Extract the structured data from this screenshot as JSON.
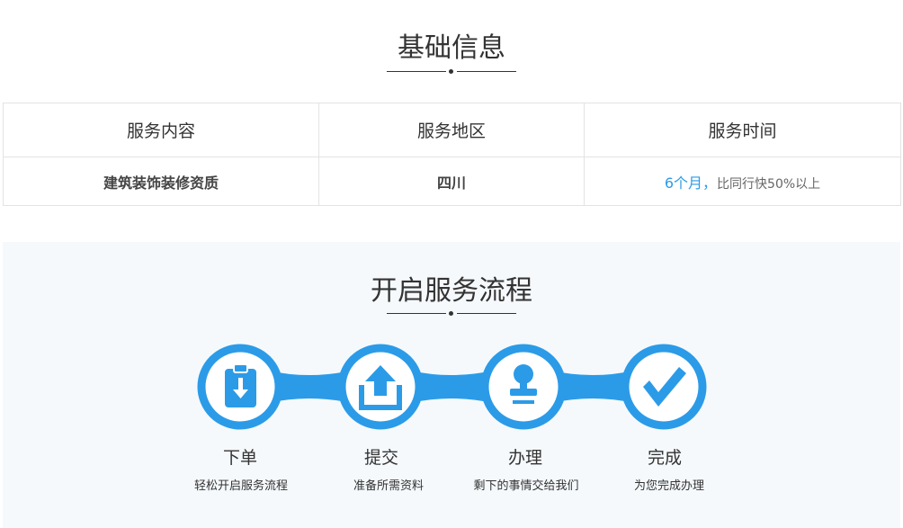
{
  "basic_info": {
    "title": "基础信息",
    "table": {
      "headers": [
        "服务内容",
        "服务地区",
        "服务时间"
      ],
      "row": {
        "content": "建筑装饰装修资质",
        "region": "四川",
        "period_highlight": "6个月，",
        "period_rest": "比同行快50%以上"
      }
    }
  },
  "process": {
    "title": "开启服务流程",
    "accent_color": "#2b9be8",
    "steps": [
      {
        "icon": "clipboard-download-icon",
        "title": "下单",
        "desc": "轻松开启服务流程"
      },
      {
        "icon": "upload-icon",
        "title": "提交",
        "desc": "准备所需资料"
      },
      {
        "icon": "stamp-icon",
        "title": "办理",
        "desc": "剩下的事情交给我们"
      },
      {
        "icon": "checkmark-icon",
        "title": "完成",
        "desc": "为您完成办理"
      }
    ]
  }
}
